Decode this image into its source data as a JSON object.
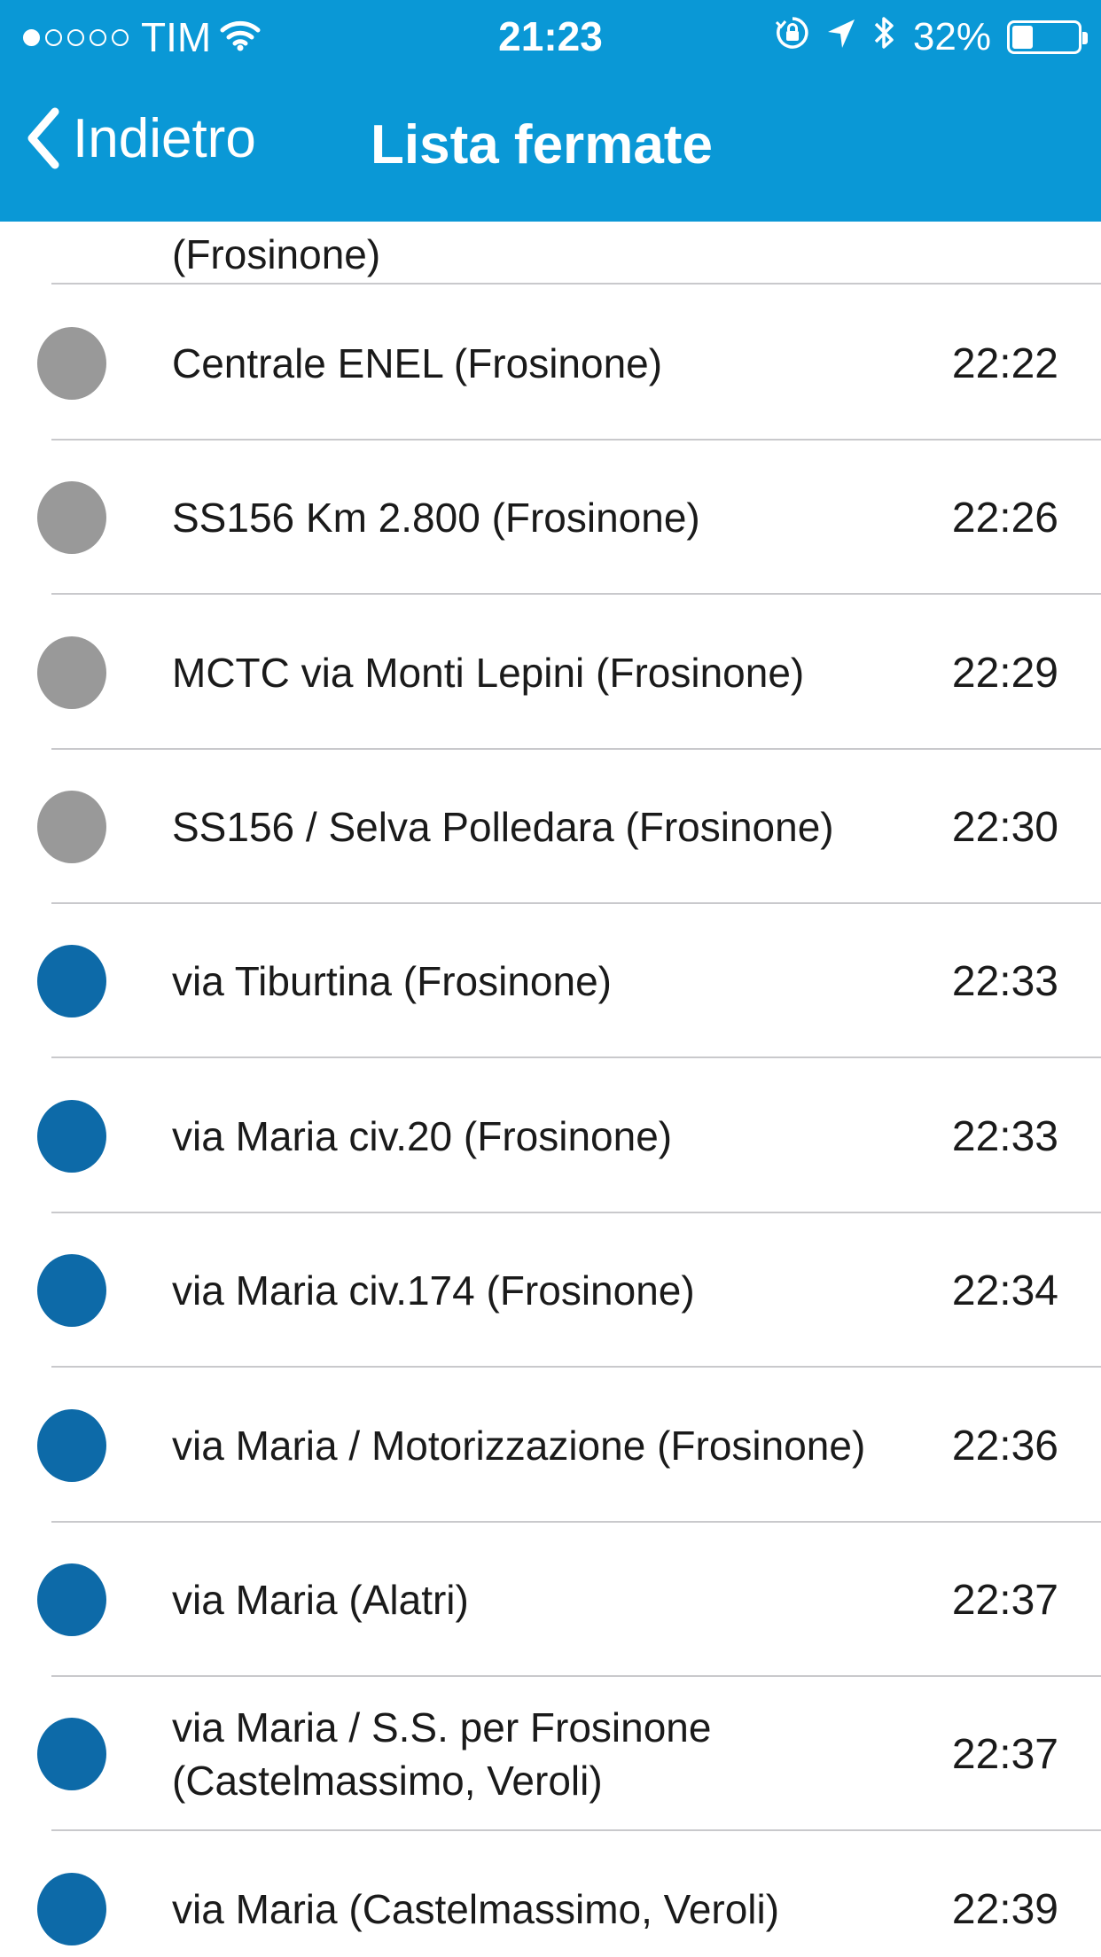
{
  "colors": {
    "accent": "#0a98d6",
    "passed": "#999999",
    "upcoming": "#0d6aa8",
    "divider": "#c9c9cc"
  },
  "status_bar": {
    "carrier": "TIM",
    "time": "21:23",
    "battery_percent": "32%",
    "battery_level": 0.32,
    "signal_bars": 1,
    "icons": [
      "wifi-icon",
      "rotation-lock-icon",
      "location-arrow-icon",
      "bluetooth-icon",
      "battery-icon"
    ]
  },
  "nav": {
    "back_label": "Indietro",
    "title": "Lista fermate"
  },
  "stops": [
    {
      "name": "(Frosinone)",
      "time": "",
      "state": "passed"
    },
    {
      "name": "Centrale ENEL (Frosinone)",
      "time": "22:22",
      "state": "passed"
    },
    {
      "name": "SS156 Km 2.800 (Frosinone)",
      "time": "22:26",
      "state": "passed"
    },
    {
      "name": "MCTC via Monti Lepini (Frosinone)",
      "time": "22:29",
      "state": "passed"
    },
    {
      "name": "SS156 / Selva Polledara (Frosinone)",
      "time": "22:30",
      "state": "passed"
    },
    {
      "name": "via Tiburtina (Frosinone)",
      "time": "22:33",
      "state": "upcoming"
    },
    {
      "name": "via Maria civ.20 (Frosinone)",
      "time": "22:33",
      "state": "upcoming"
    },
    {
      "name": "via Maria civ.174 (Frosinone)",
      "time": "22:34",
      "state": "upcoming"
    },
    {
      "name": "via Maria / Motorizzazione (Frosinone)",
      "time": "22:36",
      "state": "upcoming"
    },
    {
      "name": "via Maria (Alatri)",
      "time": "22:37",
      "state": "upcoming"
    },
    {
      "name": "via Maria / S.S. per Frosinone (Castelmassimo, Veroli)",
      "time": "22:37",
      "state": "upcoming"
    },
    {
      "name": "via Maria (Castelmassimo, Veroli)",
      "time": "22:39",
      "state": "upcoming"
    }
  ]
}
